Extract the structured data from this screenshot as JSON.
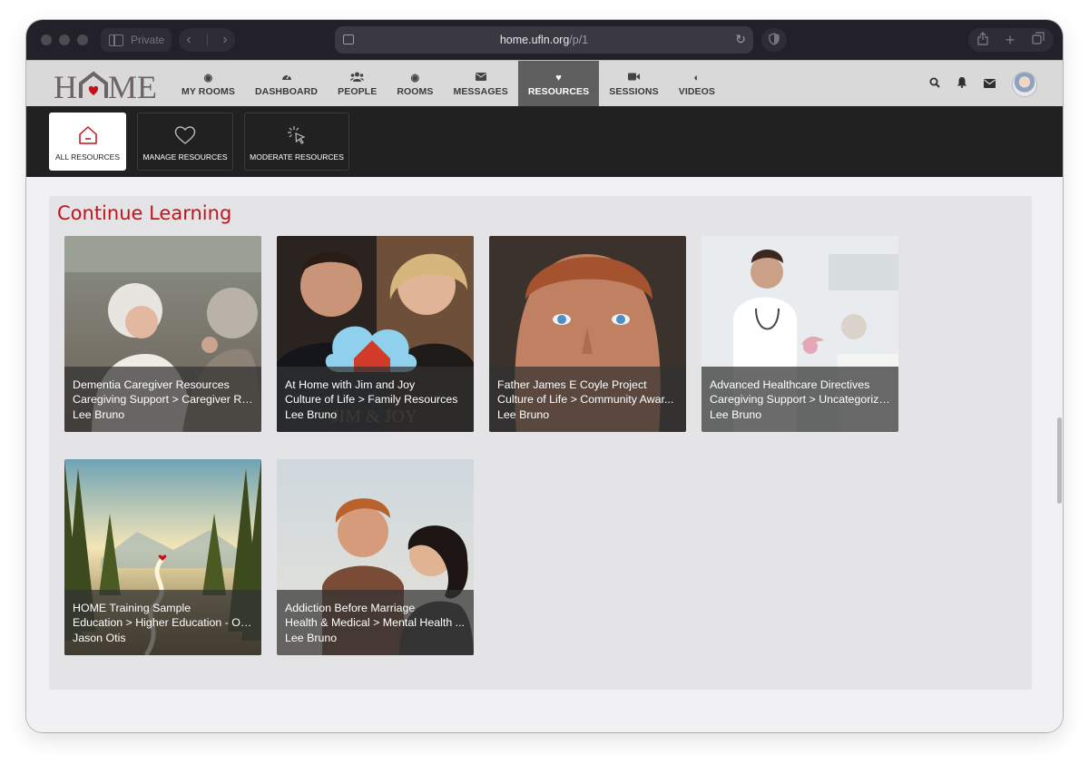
{
  "browser": {
    "private_label": "Private",
    "url_host": "home.ufln.org",
    "url_path": "/p/1"
  },
  "logo": {
    "text_left": "H",
    "text_right": "ME",
    "heart_color": "#c4121c"
  },
  "nav": {
    "items": [
      {
        "label": "MY ROOMS",
        "icon": "target-icon"
      },
      {
        "label": "DASHBOARD",
        "icon": "gauge-icon"
      },
      {
        "label": "PEOPLE",
        "icon": "users-icon"
      },
      {
        "label": "ROOMS",
        "icon": "target-icon"
      },
      {
        "label": "MESSAGES",
        "icon": "envelope-icon"
      },
      {
        "label": "RESOURCES",
        "icon": "heart-icon"
      },
      {
        "label": "SESSIONS",
        "icon": "video-camera-icon"
      },
      {
        "label": "VIDEOS",
        "icon": "contrast-icon"
      }
    ],
    "active": "RESOURCES"
  },
  "subnav": {
    "tabs": [
      {
        "label": "ALL RESOURCES"
      },
      {
        "label": "MANAGE RESOURCES"
      },
      {
        "label": "MODERATE RESOURCES"
      }
    ],
    "active": "ALL RESOURCES"
  },
  "section": {
    "title": "Continue Learning"
  },
  "cards": [
    {
      "title": "Dementia Caregiver Resources",
      "category": "Caregiving Support > Caregiver Re...",
      "author": "Lee Bruno"
    },
    {
      "title": "At Home with Jim and Joy",
      "category": "Culture of Life > Family Resources",
      "author": "Lee Bruno"
    },
    {
      "title": "Father James E Coyle Project",
      "category": "Culture of Life > Community Awar...",
      "author": "Lee Bruno"
    },
    {
      "title": "Advanced Healthcare Directives",
      "category": "Caregiving Support > Uncategorized",
      "author": "Lee Bruno"
    },
    {
      "title": "HOME Training Sample",
      "category": "Education > Higher Education - On...",
      "author": "Jason Otis"
    },
    {
      "title": "Addiction Before Marriage",
      "category": "Health & Medical > Mental Health ...",
      "author": "Lee Bruno"
    }
  ],
  "colors": {
    "accent": "#c4121c",
    "nav_active": "#5f5f5f",
    "subnav_bg": "#212121"
  }
}
